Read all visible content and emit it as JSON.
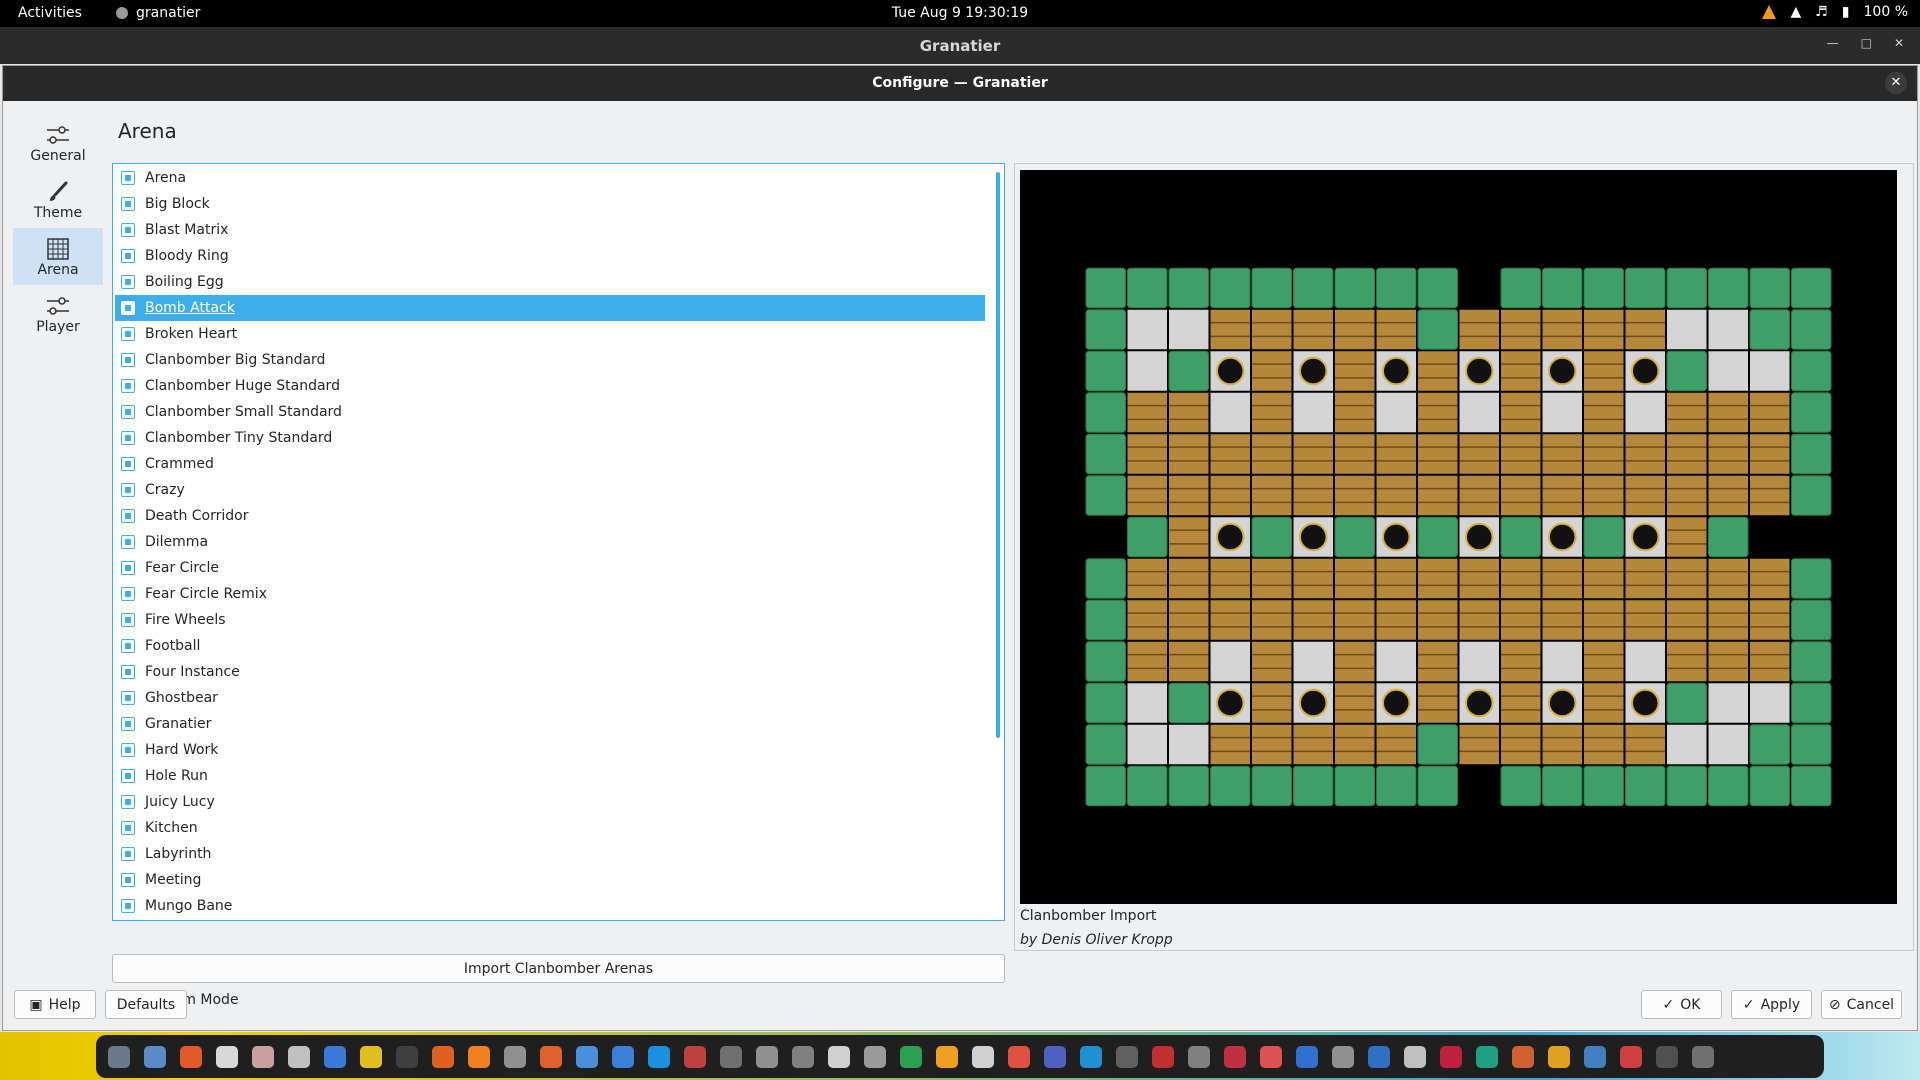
{
  "topbar": {
    "activities": "Activities",
    "app": "granatier",
    "clock": "Tue Aug 9  19:30:19",
    "battery": "100 %"
  },
  "window": {
    "title": "Granatier"
  },
  "dialog": {
    "title": "Configure — Granatier",
    "nav": [
      {
        "label": "General",
        "icon": "general-sliders-icon"
      },
      {
        "label": "Theme",
        "icon": "brush-icon"
      },
      {
        "label": "Arena",
        "icon": "grid-icon"
      },
      {
        "label": "Player",
        "icon": "player-sliders-icon"
      }
    ],
    "page_title": "Arena",
    "arenas": [
      "Arena",
      "Big Block",
      "Blast Matrix",
      "Bloody Ring",
      "Boiling Egg",
      "Bomb Attack",
      "Broken Heart",
      "Clanbomber Big Standard",
      "Clanbomber Huge Standard",
      "Clanbomber Small Standard",
      "Clanbomber Tiny Standard",
      "Crammed",
      "Crazy",
      "Death Corridor",
      "Dilemma",
      "Fear Circle",
      "Fear Circle Remix",
      "Fire Wheels",
      "Football",
      "Four Instance",
      "Ghostbear",
      "Granatier",
      "Hard Work",
      "Hole Run",
      "Juicy Lucy",
      "Kitchen",
      "Labyrinth",
      "Meeting",
      "Mungo Bane"
    ],
    "selected_arena": "Bomb Attack",
    "random_mode": "Random Mode",
    "import_button": "Import Clanbomber Arenas",
    "preview": {
      "name": "Clanbomber Import",
      "author": "by Denis Oliver Kropp"
    },
    "buttons": {
      "help": "Help",
      "defaults": "Defaults",
      "ok": "OK",
      "apply": "Apply",
      "cancel": "Cancel"
    }
  },
  "colors": {
    "accent": "#3daee9",
    "wall_green": "#3f9f68",
    "brick": "#b5883c",
    "floor": "#d4d4d4"
  },
  "arena_map": [
    "WWWWWWWWW.WWWWWWWW",
    "WFFBBBBBWBBBBBFFWW",
    "WFWHBHBHBHBHBHWFFW",
    "WBBFBFBFBFBFBFBBBW",
    "WBBBBBBBBBBBBBBBBW",
    "WBBBBBBBBBBBBBBBBW",
    ".WBHWHWHWHWHWHBW..",
    "WBBBBBBBBBBBBBBBBW",
    "WBBBBBBBBBBBBBBBBW",
    "WBBFBFBFBFBFBFBBBW",
    "WFWHBHBHBHBHBHWFFW",
    "WFFBBBBBWBBBBBFFWW",
    "WWWWWWWWW.WWWWWWWW"
  ]
}
